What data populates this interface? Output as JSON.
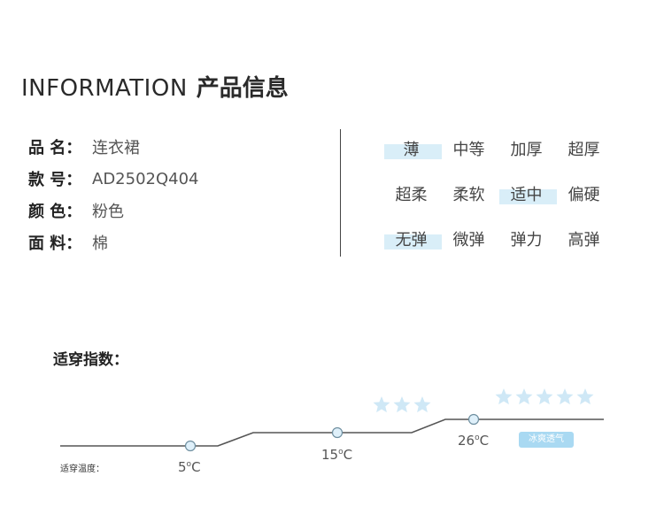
{
  "header": {
    "title_en": "INFORMATION",
    "title_cn": "产品信息"
  },
  "info": [
    {
      "key": "品 名：",
      "value": "连衣裙"
    },
    {
      "key": "款 号：",
      "value": "AD2502Q404"
    },
    {
      "key": "颜 色：",
      "value": "粉色"
    },
    {
      "key": "面 料：",
      "value": "棉"
    }
  ],
  "attributes": [
    {
      "options": [
        "薄",
        "中等",
        "加厚",
        "超厚"
      ],
      "selected_index": 0
    },
    {
      "options": [
        "超柔",
        "柔软",
        "适中",
        "偏硬"
      ],
      "selected_index": 2
    },
    {
      "options": [
        "无弹",
        "微弹",
        "弹力",
        "高弹"
      ],
      "selected_index": 0
    }
  ],
  "suitability": {
    "title": "适穿指数：",
    "temp_label": "适穿温度：",
    "temps": [
      {
        "num": "5",
        "deg": "o",
        "unit": "C"
      },
      {
        "num": "15",
        "deg": "o",
        "unit": "C"
      },
      {
        "num": "26",
        "deg": "o",
        "unit": "C"
      }
    ],
    "stars_mid": 3,
    "stars_right": 5,
    "badge": "冰爽透气",
    "colors": {
      "line": "#555555",
      "star": "#cfe8f6",
      "marker_fill": "#dff0fa",
      "marker_stroke": "#6f8fa0"
    }
  }
}
